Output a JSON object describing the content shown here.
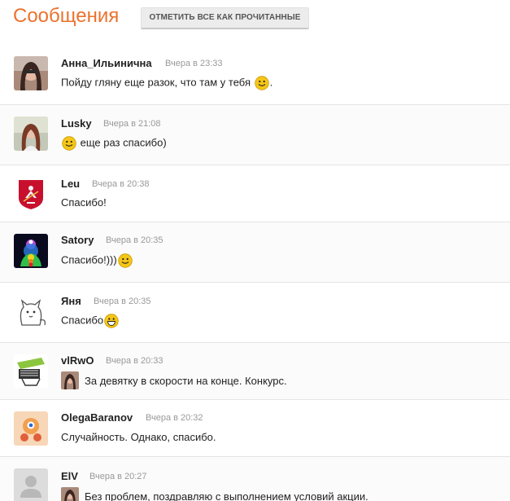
{
  "header": {
    "title": "Сообщения",
    "mark_all_read": "ОТМЕТИТЬ ВСЕ КАК ПРОЧИТАННЫЕ"
  },
  "messages": [
    {
      "name": "Анна_Ильинична",
      "time": "Вчера в 23:33",
      "text_before": "Пойду гляну еще разок, что там у тебя ",
      "text_after": ".",
      "smiley": "smile"
    },
    {
      "name": "Lusky",
      "time": "Вчера в 21:08",
      "text_before": "",
      "text_after": " еще раз спасибо)",
      "smiley": "smile"
    },
    {
      "name": "Leu",
      "time": "Вчера в 20:38",
      "text_before": "Спасибо!",
      "text_after": "",
      "smiley": "none"
    },
    {
      "name": "Satory",
      "time": "Вчера в 20:35",
      "text_before": "Спасибо!)))",
      "text_after": "",
      "smiley": "smile"
    },
    {
      "name": "Яня",
      "time": "Вчера в 20:35",
      "text_before": "Спасибо",
      "text_after": "",
      "smiley": "grin"
    },
    {
      "name": "vlRwO",
      "time": "Вчера в 20:33",
      "text_before": "За девятку в скорости на конце. Конкурс.",
      "text_after": "",
      "smiley": "none"
    },
    {
      "name": "OlegaBaranov",
      "time": "Вчера в 20:32",
      "text_before": "Случайность. Однако, спасибо.",
      "text_after": "",
      "smiley": "none"
    },
    {
      "name": "ElV",
      "time": "Вчера в 20:27",
      "text_before": "Без проблем, поздравляю с выполнением условий акции.",
      "text_after": "",
      "smiley": "none"
    }
  ],
  "colors": {
    "title": "#eb722e",
    "smiley": "#f5c518"
  }
}
